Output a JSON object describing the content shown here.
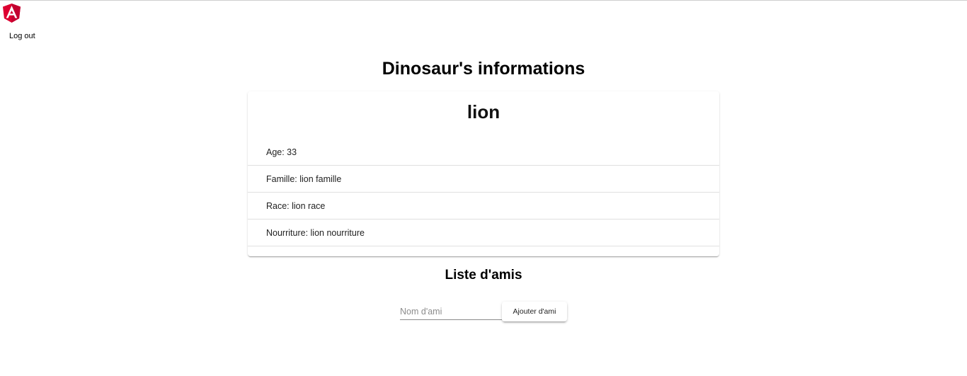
{
  "header": {
    "logo_icon": "angular-logo-icon",
    "logo_color": "#dd0031",
    "logout_label": "Log out"
  },
  "page_title": "Dinosaur's informations",
  "dinosaur": {
    "name": "lion",
    "details": [
      {
        "text": "Age: 33"
      },
      {
        "text": "Famille: lion famille"
      },
      {
        "text": "Race: lion race"
      },
      {
        "text": "Nourriture: lion nourriture"
      }
    ]
  },
  "friends": {
    "title": "Liste d'amis",
    "input_placeholder": "Nom d'ami",
    "input_value": "",
    "add_button_label": "Ajouter d'ami"
  }
}
